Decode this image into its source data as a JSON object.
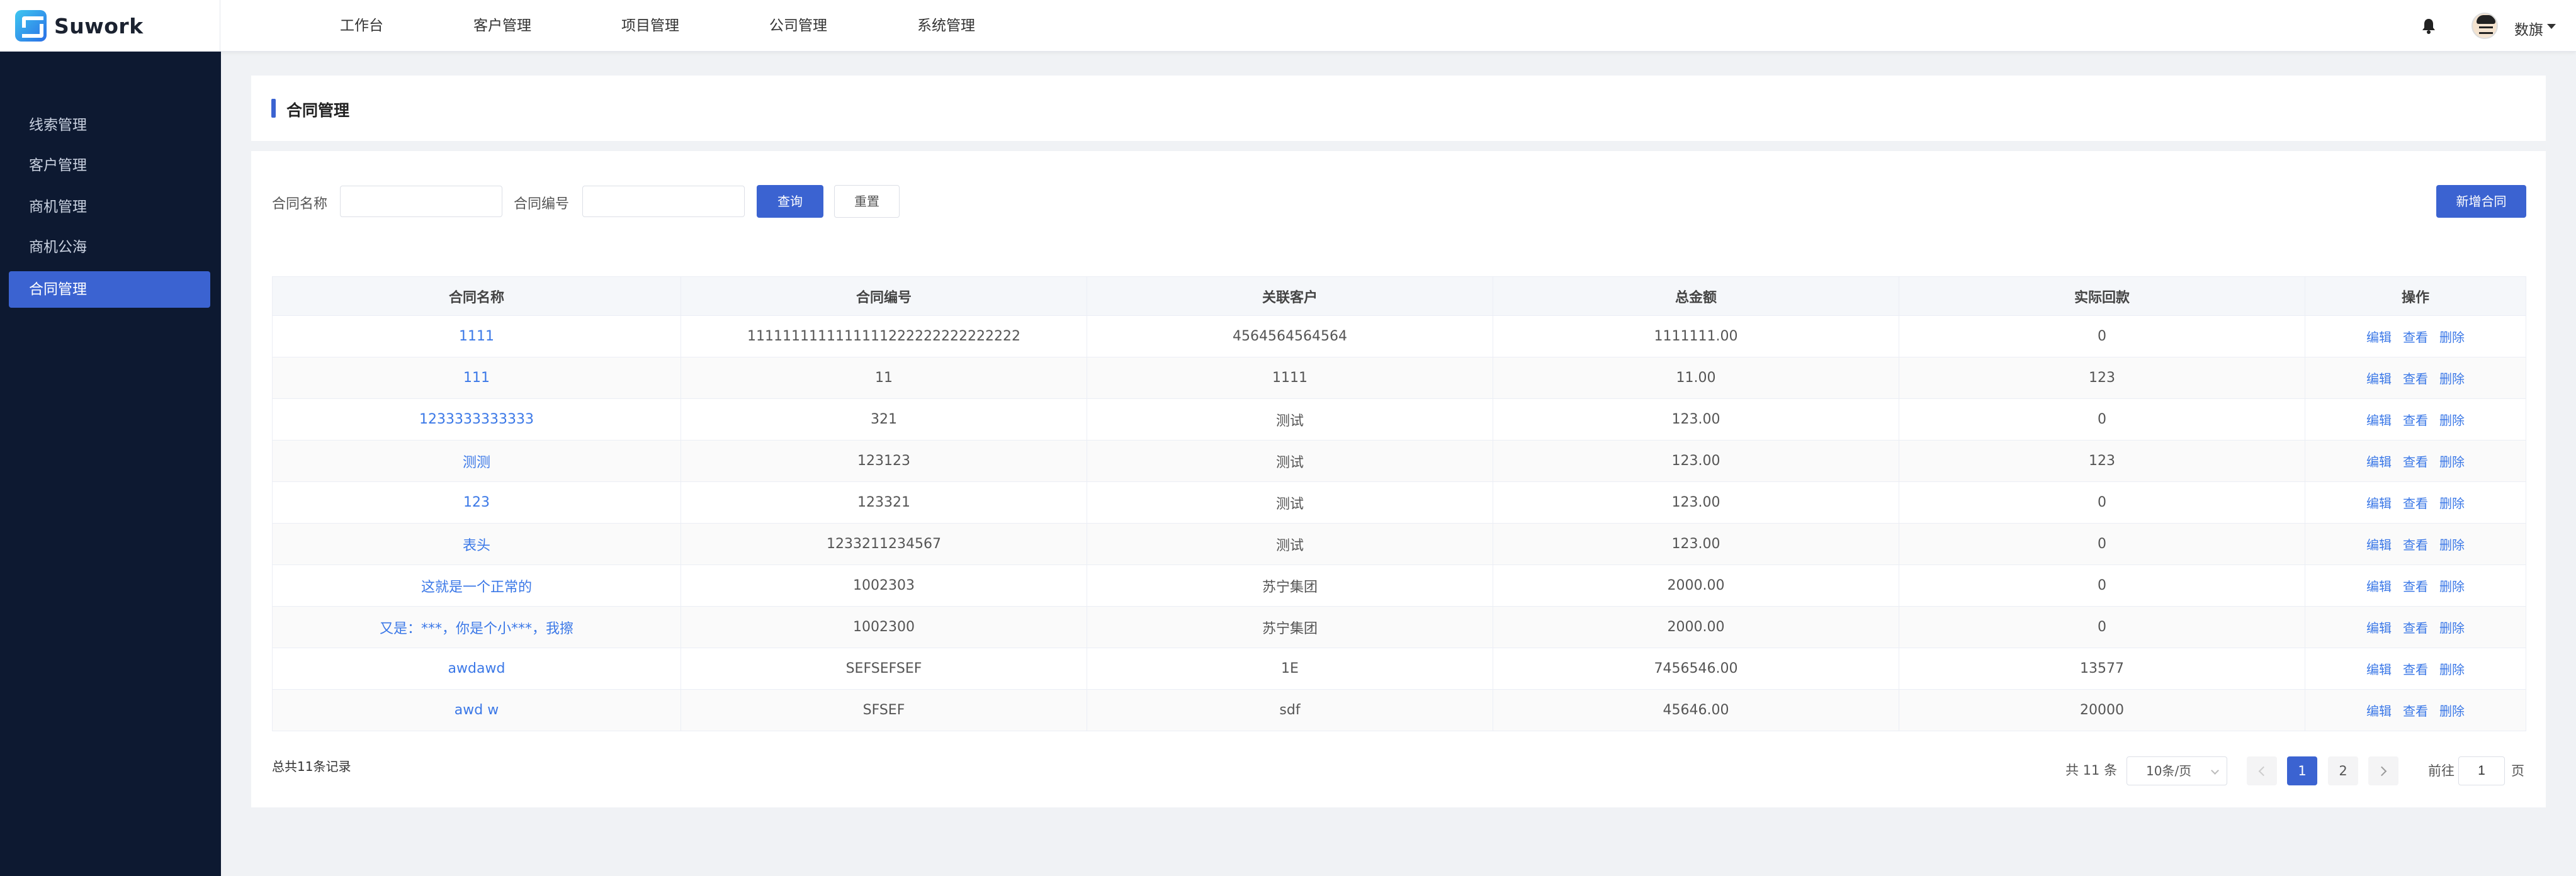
{
  "app": {
    "logo_text": "Suwork"
  },
  "nav": {
    "items": [
      "工作台",
      "客户管理",
      "项目管理",
      "公司管理",
      "系统管理"
    ]
  },
  "header": {
    "user_name": "数旗"
  },
  "sidebar": {
    "items": [
      {
        "label": "线索管理"
      },
      {
        "label": "客户管理"
      },
      {
        "label": "商机管理"
      },
      {
        "label": "商机公海"
      },
      {
        "label": "合同管理",
        "active": true
      }
    ]
  },
  "page": {
    "title": "合同管理"
  },
  "filters": {
    "name_label": "合同名称",
    "name_value": "",
    "name_placeholder": "",
    "code_label": "合同编号",
    "code_value": "",
    "code_placeholder": "",
    "search_button": "查询",
    "reset_button": "重置",
    "add_button": "新增合同"
  },
  "table": {
    "columns": [
      "合同名称",
      "合同编号",
      "关联客户",
      "总金额",
      "实际回款",
      "操作"
    ],
    "actions": [
      "编辑",
      "查看",
      "删除"
    ],
    "rows": [
      [
        "1111",
        "1111111111111111222222222222222",
        "4564564564564",
        "1111111.00",
        "0"
      ],
      [
        "111",
        "11",
        "1111",
        "11.00",
        "123"
      ],
      [
        "1233333333333",
        "321",
        "测试",
        "123.00",
        "0"
      ],
      [
        "测测",
        "123123",
        "测试",
        "123.00",
        "123"
      ],
      [
        "123",
        "123321",
        "测试",
        "123.00",
        "0"
      ],
      [
        "表头",
        "1233211234567",
        "测试",
        "123.00",
        "0"
      ],
      [
        "这就是一个正常的",
        "1002303",
        "苏宁集团",
        "2000.00",
        "0"
      ],
      [
        "又是：***，你是个小***，我擦",
        "1002300",
        "苏宁集团",
        "2000.00",
        "0"
      ],
      [
        "awdawd",
        "SEFSEFSEF",
        "1E",
        "7456546.00",
        "13577"
      ],
      [
        "awd w",
        "SFSEF",
        "sdf",
        "45646.00",
        "20000"
      ]
    ]
  },
  "footer": {
    "total_text": "总共11条记录"
  },
  "pagination": {
    "total_text": "共 11 条",
    "page_size": "10条/页",
    "pages": [
      "1",
      "2"
    ],
    "current_page": 1,
    "goto_prefix": "前往",
    "goto_value": "1",
    "goto_suffix": "页"
  },
  "colors": {
    "primary": "#3b63d1",
    "sidebar_bg": "#0d1931",
    "link": "#3b78e7"
  }
}
